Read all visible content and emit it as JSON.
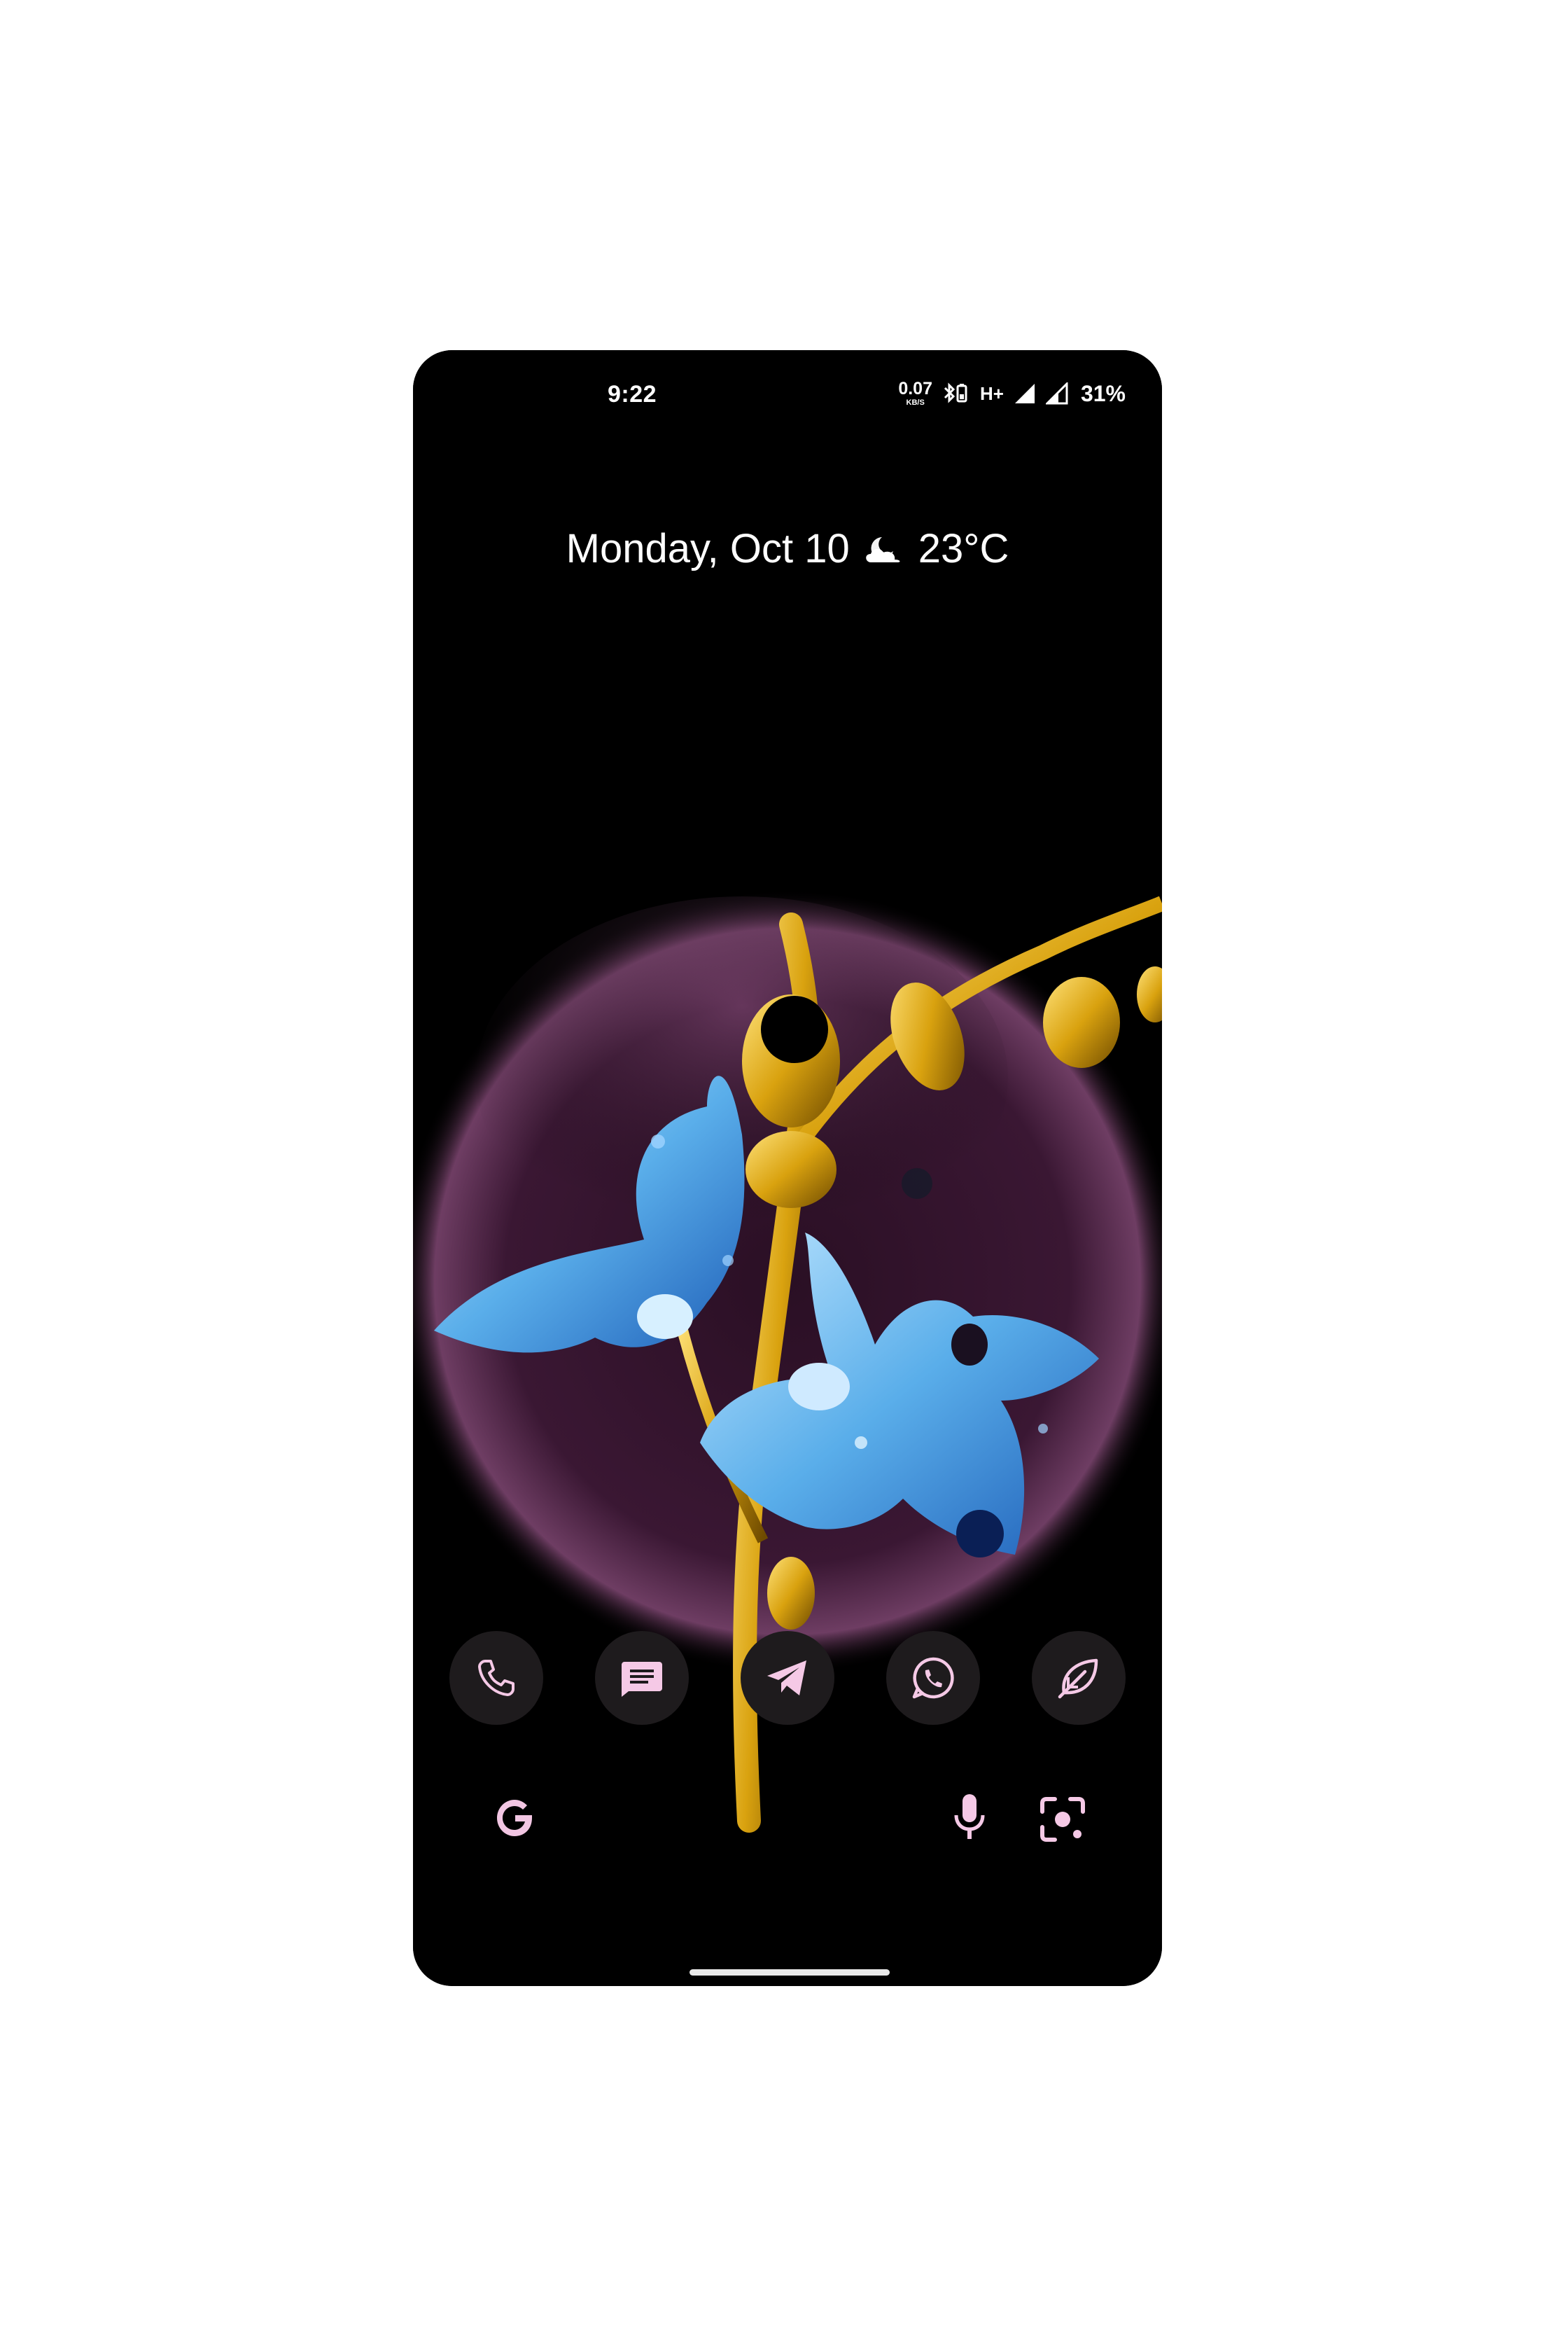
{
  "status_bar": {
    "time": "9:22",
    "net_speed_value": "0.07",
    "net_speed_unit": "KB/S",
    "network_type": "H+",
    "battery": "31%"
  },
  "date_widget": {
    "date": "Monday, Oct 10",
    "temperature": "23°C",
    "weather_icon": "partly-cloudy-night-icon"
  },
  "dock": {
    "apps": [
      {
        "name": "Phone",
        "icon": "phone-icon"
      },
      {
        "name": "Messages",
        "icon": "messages-icon"
      },
      {
        "name": "Telegram",
        "icon": "telegram-icon"
      },
      {
        "name": "WhatsApp",
        "icon": "whatsapp-icon"
      },
      {
        "name": "Leaf app",
        "icon": "leaf-icon"
      }
    ]
  },
  "search": {
    "logo": "google-g-icon",
    "mic": "microphone-icon",
    "lens": "lens-icon"
  },
  "colors": {
    "icon_pink": "#f5c9e6",
    "dock_bg": "#1e1b1d",
    "wallpaper_glow": "#8a4b78",
    "petal_blue": "#5ab0ea",
    "stem_gold": "#d9a20f"
  }
}
